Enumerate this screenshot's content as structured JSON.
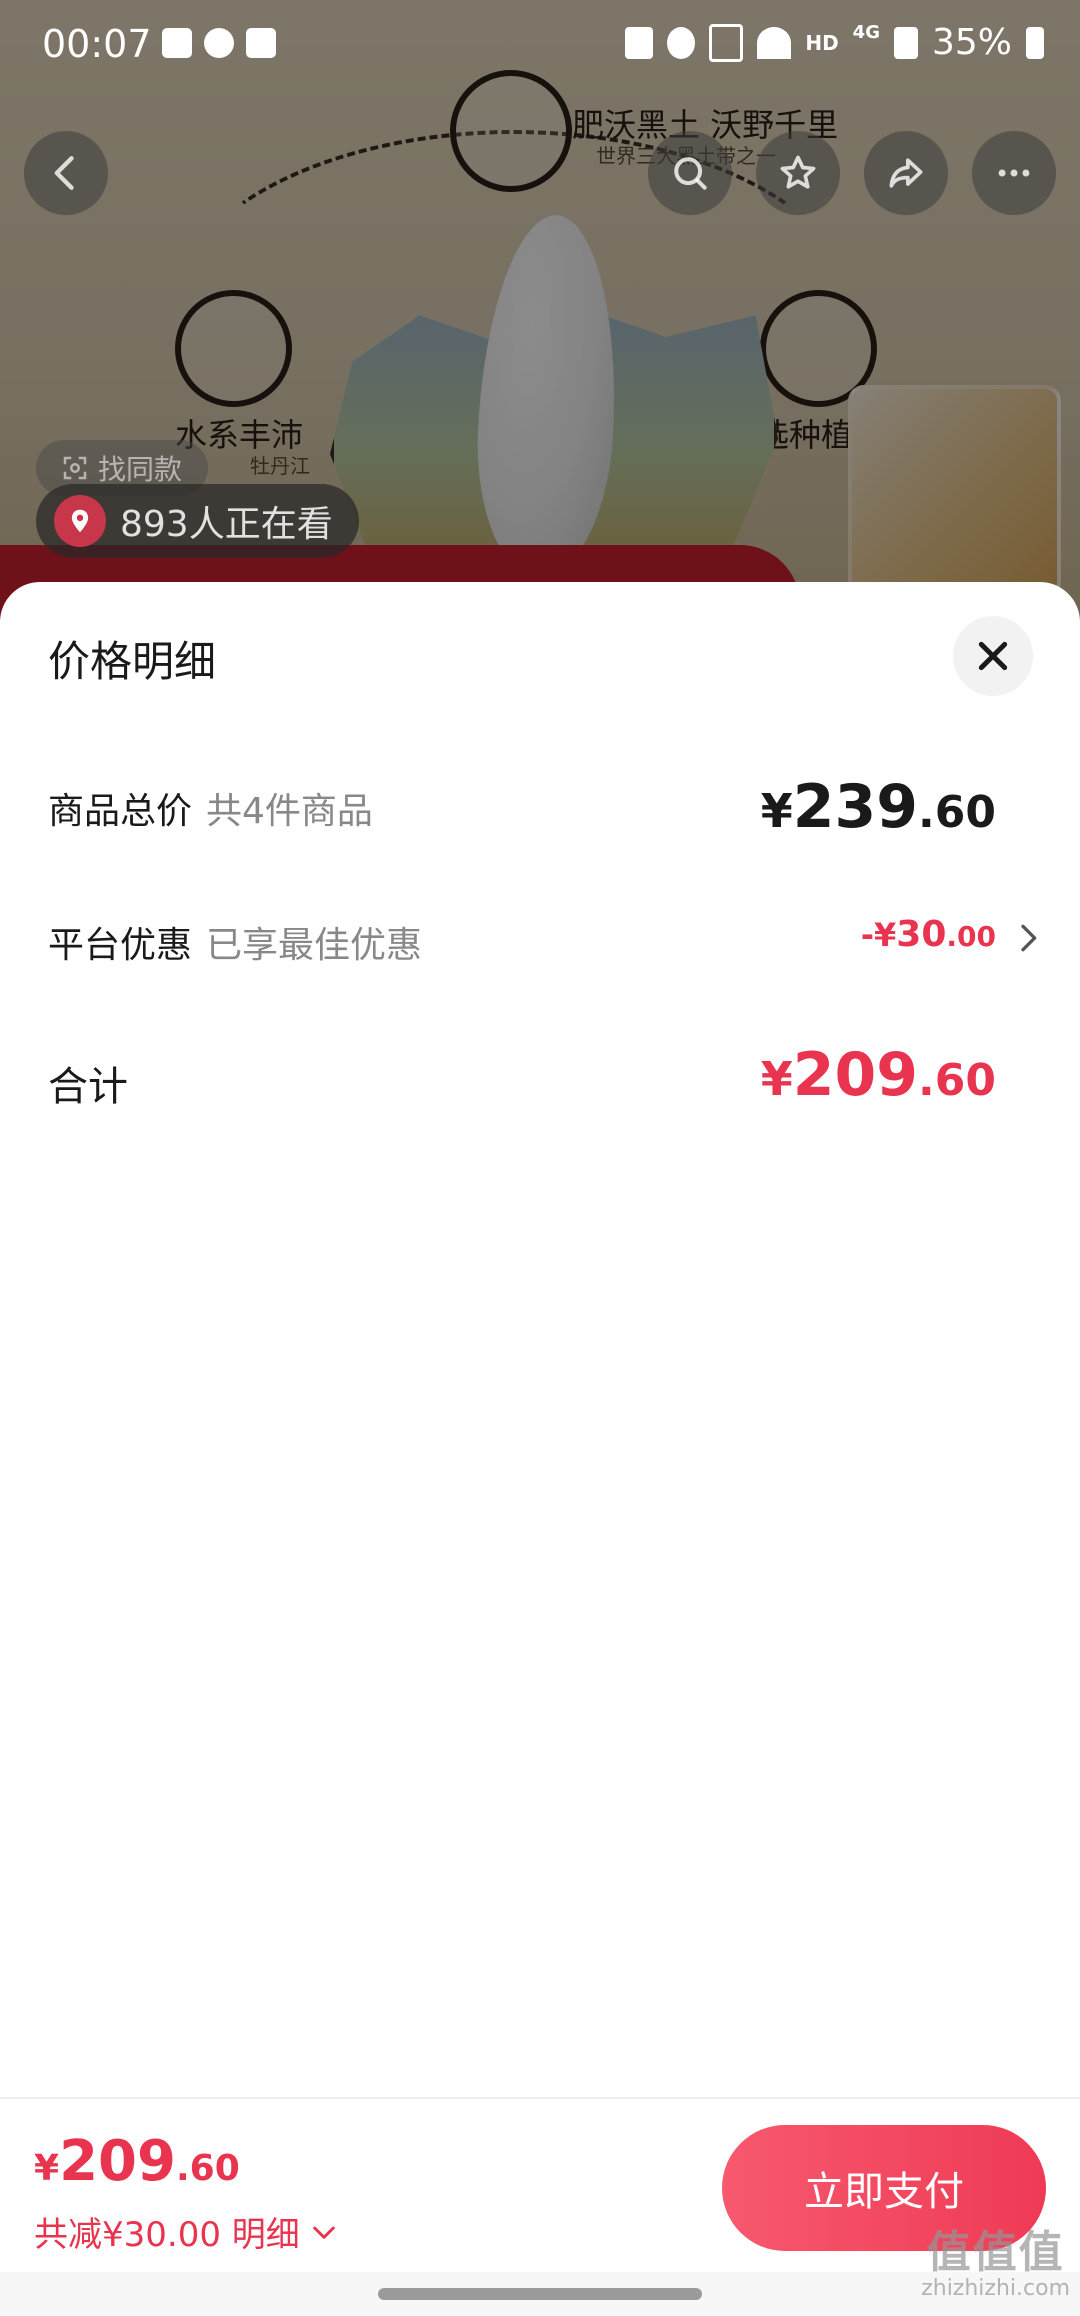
{
  "status_bar": {
    "time": "00:07",
    "hd": "HD",
    "network": "4G",
    "battery": "35%"
  },
  "background_page": {
    "feature_top": "肥沃黑土 沃野千里",
    "feature_top_sub": "世界三大黑土带之一",
    "feature_left": "水系丰沛",
    "feature_left_sub": "牡丹江",
    "feature_right": "优选种植",
    "find_same_label": "找同款",
    "viewers_text": "893人正在看"
  },
  "sheet": {
    "title": "价格明细",
    "rows": [
      {
        "label": "商品总价",
        "sublabel": "共4件商品",
        "price_currency": "¥",
        "price_int": "239",
        "price_dec": ".60"
      },
      {
        "label": "平台优惠",
        "sublabel": "已享最佳优惠",
        "price_currency": "-¥",
        "price_int": "30",
        "price_dec": ".00"
      },
      {
        "label": "合计",
        "price_currency": "¥",
        "price_int": "209",
        "price_dec": ".60"
      }
    ]
  },
  "bottom_bar": {
    "price_currency": "¥",
    "price_int": "209",
    "price_dec": ".60",
    "saved_text": "共减¥30.00 明细",
    "pay_label": "立即支付"
  },
  "watermark": {
    "logo": "值值值",
    "site": "zhizhizhi.com"
  },
  "colors": {
    "accent_red": "#e8344e",
    "text_primary": "#1a1a1a",
    "text_secondary": "#888888"
  }
}
